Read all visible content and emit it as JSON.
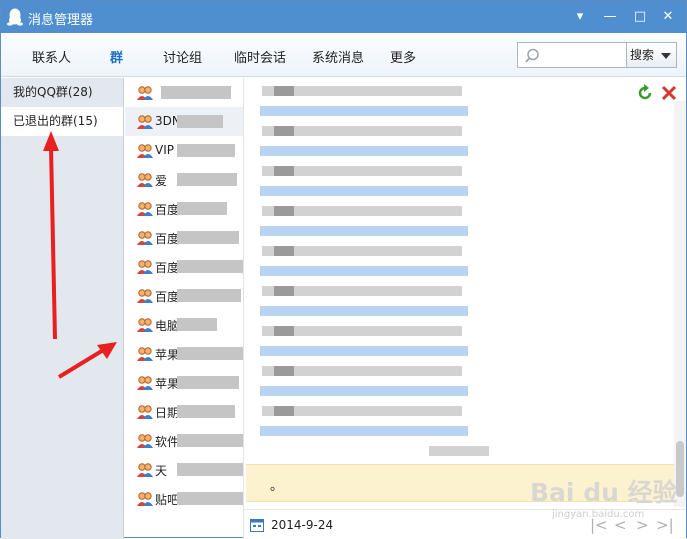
{
  "window": {
    "title": "消息管理器",
    "minimize_label": "▾",
    "restore_label": "—",
    "maximize_label": "□",
    "close_label": "✕"
  },
  "toolbar": {
    "tabs": [
      {
        "label": "联系人"
      },
      {
        "label": "群"
      },
      {
        "label": "讨论组"
      },
      {
        "label": "临时会话"
      },
      {
        "label": "系统消息"
      },
      {
        "label": "更多"
      }
    ],
    "active_tab": "群",
    "search_placeholder": "",
    "search_button": "搜索"
  },
  "sidebar": {
    "items": [
      {
        "label": "我的QQ群(28)"
      },
      {
        "label": "已退出的群(15)"
      }
    ],
    "selected": "已退出的群(15)"
  },
  "group_list": {
    "rows": [
      {
        "name": ""
      },
      {
        "name": "3DN"
      },
      {
        "name": "VIP"
      },
      {
        "name": "爱"
      },
      {
        "name": "百度"
      },
      {
        "name": "百度"
      },
      {
        "name": "百度"
      },
      {
        "name": "百度"
      },
      {
        "name": "电脑"
      },
      {
        "name": "苹果"
      },
      {
        "name": "苹果"
      },
      {
        "name": "日期"
      },
      {
        "name": "软件"
      },
      {
        "name": "天"
      },
      {
        "name": "贴吧"
      }
    ]
  },
  "message_view": {
    "trailing_text": "。"
  },
  "footer": {
    "date": "2014-9-24",
    "pager": [
      "|<",
      "<",
      ">",
      ">|"
    ]
  },
  "watermark": {
    "brand": "Bai du 经验",
    "url": "jingyan.baidu.com"
  },
  "colors": {
    "title_bar": "#4f8fd0",
    "active_tab": "#1d6fc3",
    "sidebar_bg": "#e3e8ee",
    "highlight_row": "#fdf2cf",
    "annotation_arrow": "#e8201f"
  }
}
